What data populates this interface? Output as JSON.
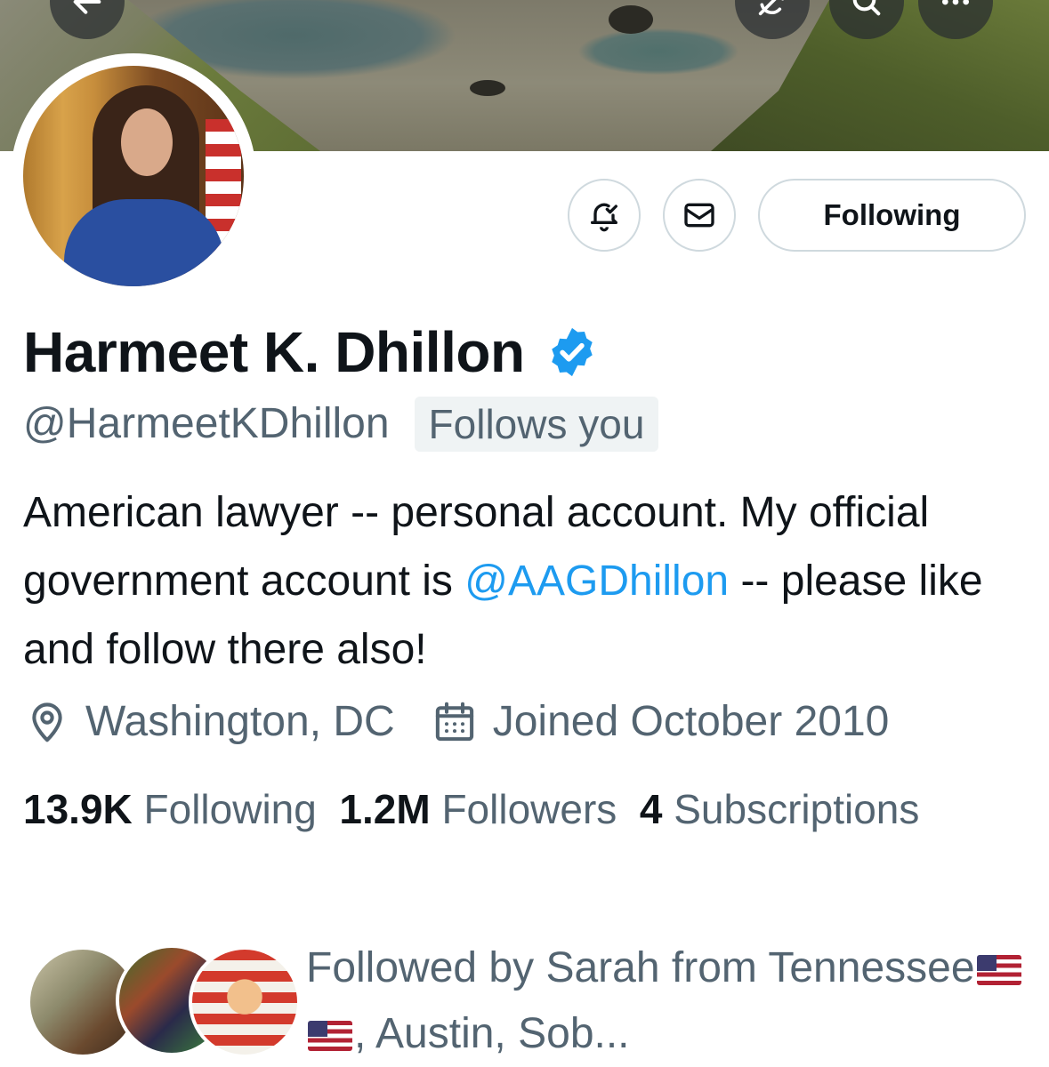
{
  "banner": {
    "back_icon": "arrow-left-icon",
    "actions": [
      "sync-icon",
      "search-icon",
      "more-icon"
    ]
  },
  "profile": {
    "name": "Harmeet K. Dhillon",
    "verified": true,
    "handle": "@HarmeetKDhillon",
    "follows_you": "Follows you",
    "bio_before": "American lawyer -- personal account. My official government account is ",
    "bio_mention": "@AAGDhillon",
    "bio_after": " -- please like and follow there also!",
    "location": "Washington, DC",
    "joined": "Joined October 2010"
  },
  "actions": {
    "notify_icon": "bell-check-icon",
    "message_icon": "envelope-icon",
    "following_label": "Following"
  },
  "stats": {
    "following_count": "13.9K",
    "following_label": "Following",
    "followers_count": "1.2M",
    "followers_label": "Followers",
    "subscriptions_count": "4",
    "subscriptions_label": "Subscriptions"
  },
  "followed_by": {
    "prefix": "Followed by Sarah from Tennessee",
    "suffix": ", Austin, Sob..."
  },
  "colors": {
    "accent": "#1d9bf0",
    "text_primary": "#0f1419",
    "text_secondary": "#536471",
    "border": "#cfd9de"
  }
}
